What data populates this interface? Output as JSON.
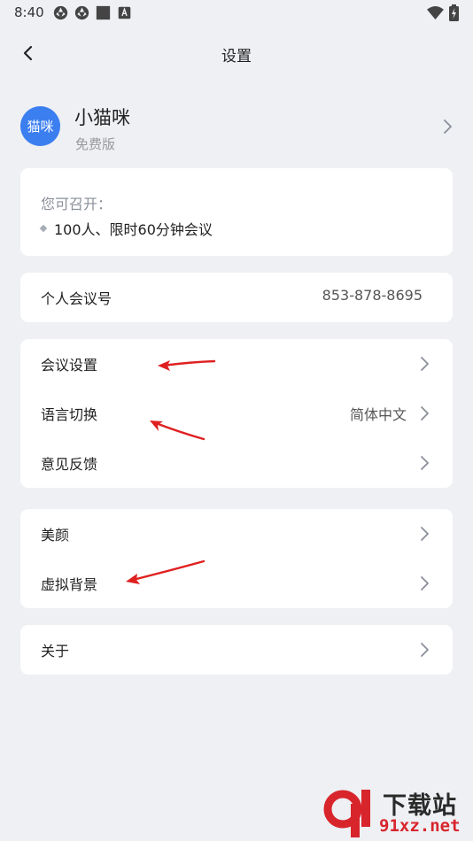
{
  "status_bar": {
    "time": "8:40",
    "left_icons": [
      "aperture-icon",
      "aperture-icon",
      "square-icon",
      "app-badge-icon"
    ],
    "right_icons": [
      "wifi-icon",
      "battery-charging-icon"
    ]
  },
  "header": {
    "title": "设置",
    "back_icon": "chevron-left-icon"
  },
  "profile": {
    "avatar_text": "猫咪",
    "name": "小猫咪",
    "plan": "免费版",
    "avatar_color": "#3b7ef0"
  },
  "quota": {
    "label": "您可召开：",
    "item": "100人、限时60分钟会议"
  },
  "meeting_id": {
    "label": "个人会议号",
    "value": "853-878-8695"
  },
  "settings_group1": {
    "items": [
      {
        "label": "会议设置",
        "value": ""
      },
      {
        "label": "语言切换",
        "value": "简体中文"
      },
      {
        "label": "意见反馈",
        "value": ""
      }
    ]
  },
  "settings_group2": {
    "items": [
      {
        "label": "美颜"
      },
      {
        "label": "虚拟背景"
      }
    ]
  },
  "settings_group3": {
    "items": [
      {
        "label": "关于"
      }
    ]
  },
  "annotation_color": "#e02020",
  "watermark": {
    "title": "下载站",
    "url": "91xz.net",
    "accent_color": "#d8252c"
  }
}
